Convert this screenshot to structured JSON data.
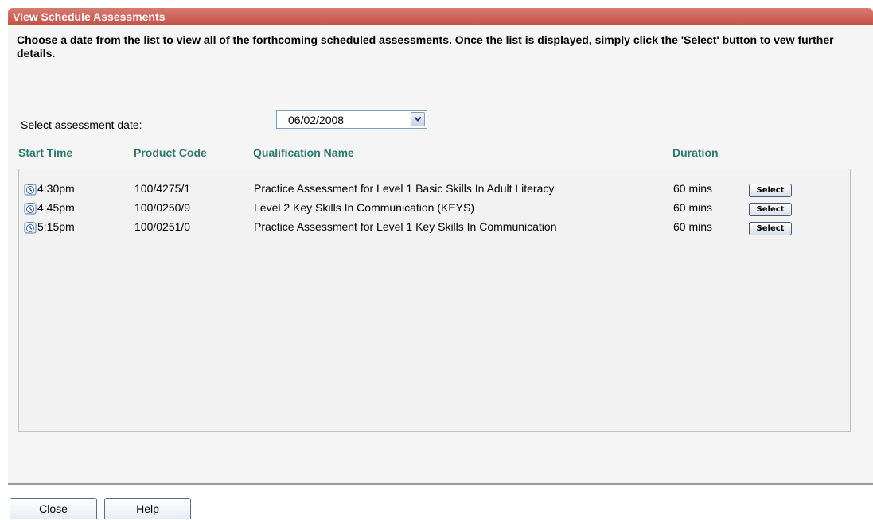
{
  "dialog": {
    "title": "View Schedule Assessments",
    "instructions": "Choose a date from the list to view all of the forthcoming scheduled assessments. Once the list is displayed, simply click the 'Select' button to vew further details.",
    "date_label": "Select assessment date:",
    "date_value": "06/02/2008"
  },
  "columns": {
    "start_time": "Start Time",
    "product_code": "Product Code",
    "qualification_name": "Qualification Name",
    "duration": "Duration"
  },
  "rows": [
    {
      "start_time": "4:30pm",
      "product_code": "100/4275/1",
      "qualification_name": "Practice Assessment for Level 1 Basic Skills In Adult Literacy",
      "duration": "60 mins",
      "action": "Select"
    },
    {
      "start_time": "4:45pm",
      "product_code": "100/0250/9",
      "qualification_name": "Level 2 Key Skills In Communication (KEYS)",
      "duration": "60 mins",
      "action": "Select"
    },
    {
      "start_time": "5:15pm",
      "product_code": "100/0251/0",
      "qualification_name": "Practice Assessment for Level 1 Key Skills In Communication",
      "duration": "60 mins",
      "action": "Select"
    }
  ],
  "footer": {
    "close_label": "Close",
    "help_label": "Help"
  },
  "colors": {
    "title_bar": "#c4524a",
    "column_header": "#2e7a6e"
  },
  "icons": {
    "row_icon": "clock-icon",
    "dropdown": "chevron-down-icon"
  }
}
